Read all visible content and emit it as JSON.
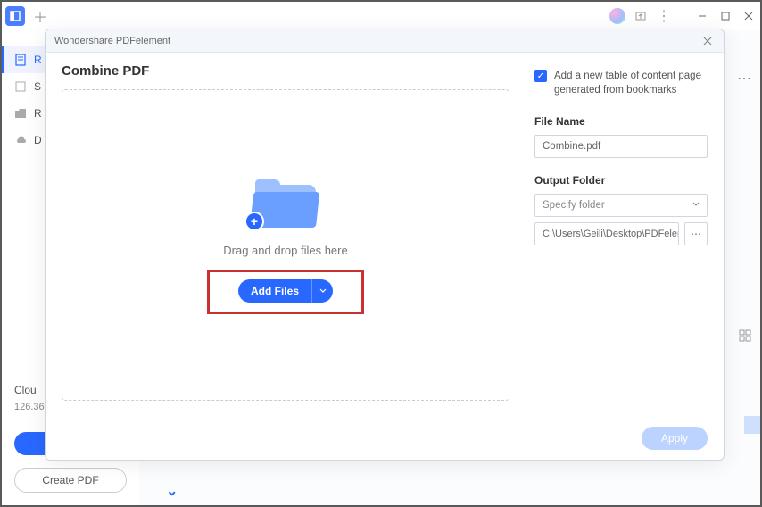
{
  "titlebar": {
    "app_icon_glyph": "⊡"
  },
  "sidebar": {
    "items": [
      {
        "label": "R"
      },
      {
        "label": "S"
      },
      {
        "label": "R"
      },
      {
        "label": "D"
      }
    ],
    "cloud_heading": "Clou",
    "cloud_value": "126.36",
    "create_pdf_label": "Create PDF"
  },
  "dialog": {
    "title": "Wondershare PDFelement",
    "heading": "Combine PDF",
    "drop_text": "Drag and drop files here",
    "add_files_label": "Add Files",
    "checkbox_label": "Add a new table of content page generated from bookmarks",
    "file_name_label": "File Name",
    "file_name_value": "Combine.pdf",
    "output_folder_label": "Output Folder",
    "specify_placeholder": "Specify folder",
    "folder_path": "C:\\Users\\Geili\\Desktop\\PDFelement\\Cc",
    "apply_label": "Apply"
  }
}
